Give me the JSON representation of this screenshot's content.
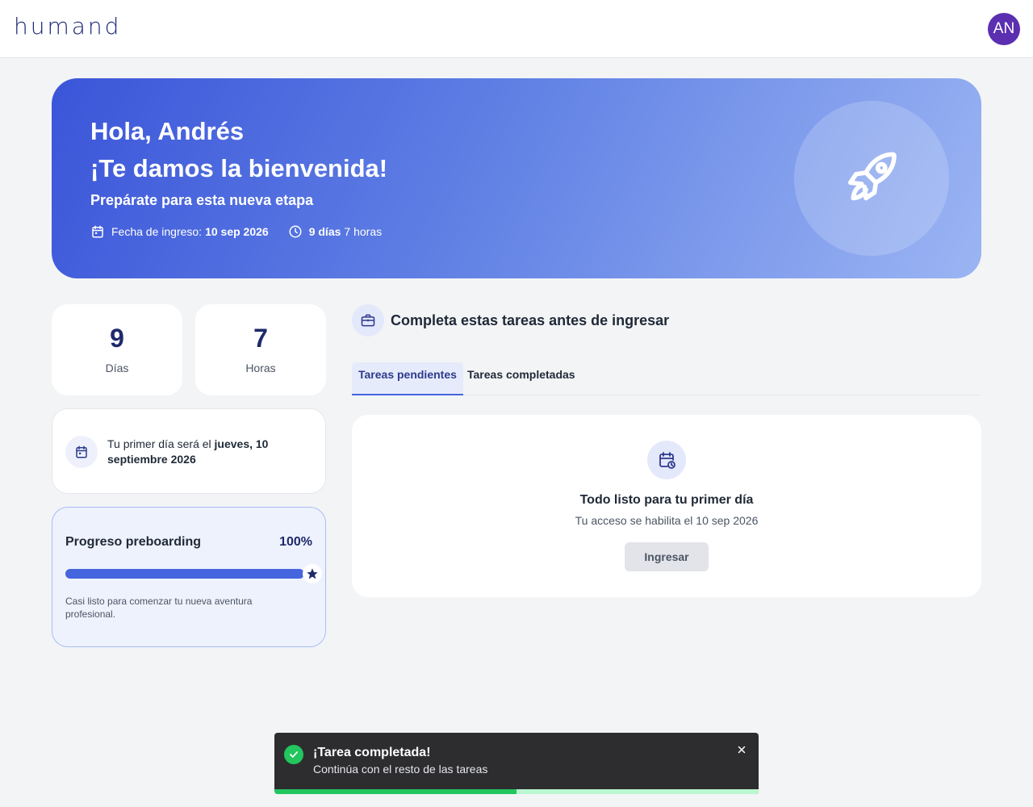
{
  "header": {
    "logo": "humand",
    "avatar_initials": "AN"
  },
  "hero": {
    "greeting": "Hola, Andrés",
    "welcome": "¡Te damos la bienvenida!",
    "subtitle": "Prepárate para esta nueva etapa",
    "start_label": "Fecha de ingreso:",
    "start_date": "10 sep 2026",
    "countdown_days": "9 días",
    "countdown_hours": "7 horas",
    "icon": "rocket-icon"
  },
  "counters": [
    {
      "value": "9",
      "label": "Días"
    },
    {
      "value": "7",
      "label": "Horas"
    }
  ],
  "first_day": {
    "prefix": "Tu primer día será el",
    "date": "jueves, 10 septiembre 2026"
  },
  "progress": {
    "title": "Progreso preboarding",
    "percent_label": "100%",
    "value": 1.0,
    "note": "Casi listo para comenzar tu nueva aventura profesional."
  },
  "tasks": {
    "title": "Completa estas tareas antes de ingresar",
    "tabs": [
      {
        "label": "Tareas pendientes",
        "active": true
      },
      {
        "label": "Tareas completadas",
        "active": false
      }
    ],
    "empty": {
      "title": "Todo listo para tu primer día",
      "subtitle": "Tu acceso se habilita el 10 sep 2026",
      "button": "Ingresar"
    }
  },
  "toast": {
    "title": "¡Tarea completada!",
    "message": "Continúa con el resto de las tareas",
    "progress": 0.5
  },
  "colors": {
    "brand": "#1e2a78",
    "accent": "#4565de",
    "avatar": "#5b2fb0",
    "success": "#22c55e"
  }
}
